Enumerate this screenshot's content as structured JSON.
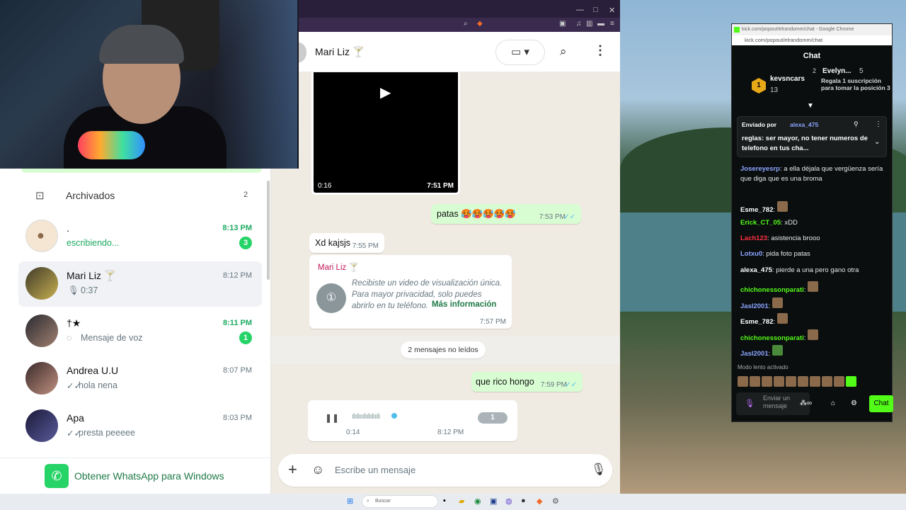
{
  "whatsapp": {
    "sidebar": {
      "archived_label": "Archivados",
      "archived_count": "2",
      "chats": [
        {
          "name": ".",
          "time": "8:13 PM",
          "subtitle": "escribiendo...",
          "badge": "3"
        },
        {
          "name": "Mari Liz 🍸",
          "time": "8:12 PM",
          "subtitle": "0:37",
          "badge": ""
        },
        {
          "name": "†★",
          "time": "8:11 PM",
          "subtitle": "Mensaje de voz",
          "badge": "1"
        },
        {
          "name": "Andrea U.U",
          "time": "8:07 PM",
          "subtitle": "hola nena",
          "badge": ""
        },
        {
          "name": "Apa",
          "time": "8:03 PM",
          "subtitle": "presta peeeee",
          "badge": ""
        }
      ],
      "get_app_label": "Obtener WhatsApp para Windows"
    },
    "conversation": {
      "contact_name": "Mari Liz 🍸",
      "video": {
        "duration": "0:16",
        "time": "7:51 PM"
      },
      "messages": [
        {
          "dir": "out",
          "text": "patas 🥵🥵🥵🥵🥵",
          "time": "7:53 PM"
        },
        {
          "dir": "in",
          "text": "Xd kajsjs",
          "time": "7:55 PM"
        }
      ],
      "view_once": {
        "sender": "Mari Liz 🍸",
        "text": "Recibiste un video de visualización única. Para mayor privacidad, solo puedes abrirlo en tu teléfono.",
        "link": "Más información",
        "time": "7:57 PM"
      },
      "unread_label": "2 mensajes no leídos",
      "message_after": {
        "dir": "out",
        "text": "que rico hongo",
        "time": "7:59 PM"
      },
      "voice": {
        "position": "0:14",
        "time": "8:12 PM",
        "speed": "1"
      },
      "composer_placeholder": "Escribe un mensaje"
    }
  },
  "kick": {
    "window_title": "kick.com/popout/elrandomm/chat - Google Chrome",
    "url": "kick.com/popout/elrandomm/chat",
    "header": "Chat",
    "leaderboard": {
      "first_user": "kevsncars",
      "first_count": "13",
      "second_rank": "2",
      "second_user": "Evelyn...",
      "second_count": "5",
      "third_text": "Regala 1 suscripción para tomar la posición 3"
    },
    "pinned": {
      "label": "Enviado por",
      "user": "alexa_475",
      "text": "reglas: ser mayor, no tener numeros de telefono en tus cha..."
    },
    "messages": [
      {
        "user": "Josereyesrp",
        "text": "a ella déjala que vergüenza sería que diga que es una broma"
      },
      {
        "user": "Esme_782",
        "text": ""
      },
      {
        "user": "Erick_CT_05",
        "text": "xDD"
      },
      {
        "user": "Lach123",
        "text": "asistencia brooo"
      },
      {
        "user": "Lotxu0",
        "text": "pida foto patas"
      },
      {
        "user": "alexa_475",
        "text": "pierde a una pero gano otra"
      },
      {
        "user": "chichonessonparati",
        "text": ""
      },
      {
        "user": "Jasl2001",
        "text": ""
      },
      {
        "user": "Esme_782",
        "text": ""
      },
      {
        "user": "chichonessonparati",
        "text": ""
      },
      {
        "user": "Jasl2001",
        "text": ""
      }
    ],
    "slow_mode": "Modo lento activado",
    "input_placeholder": "Enviar un mensaje",
    "chat_button": "Chat",
    "colors": {
      "kick_green": "#53fc18",
      "user_blue": "#8aa4ff",
      "user_green": "#53fc18",
      "user_red": "#ff3040"
    }
  },
  "taskbar": {
    "search_placeholder": "Buscar"
  },
  "colors": {
    "wa_green": "#25d366",
    "wa_bubble_out": "#d9fdd3",
    "wa_bg": "#efeae2"
  }
}
